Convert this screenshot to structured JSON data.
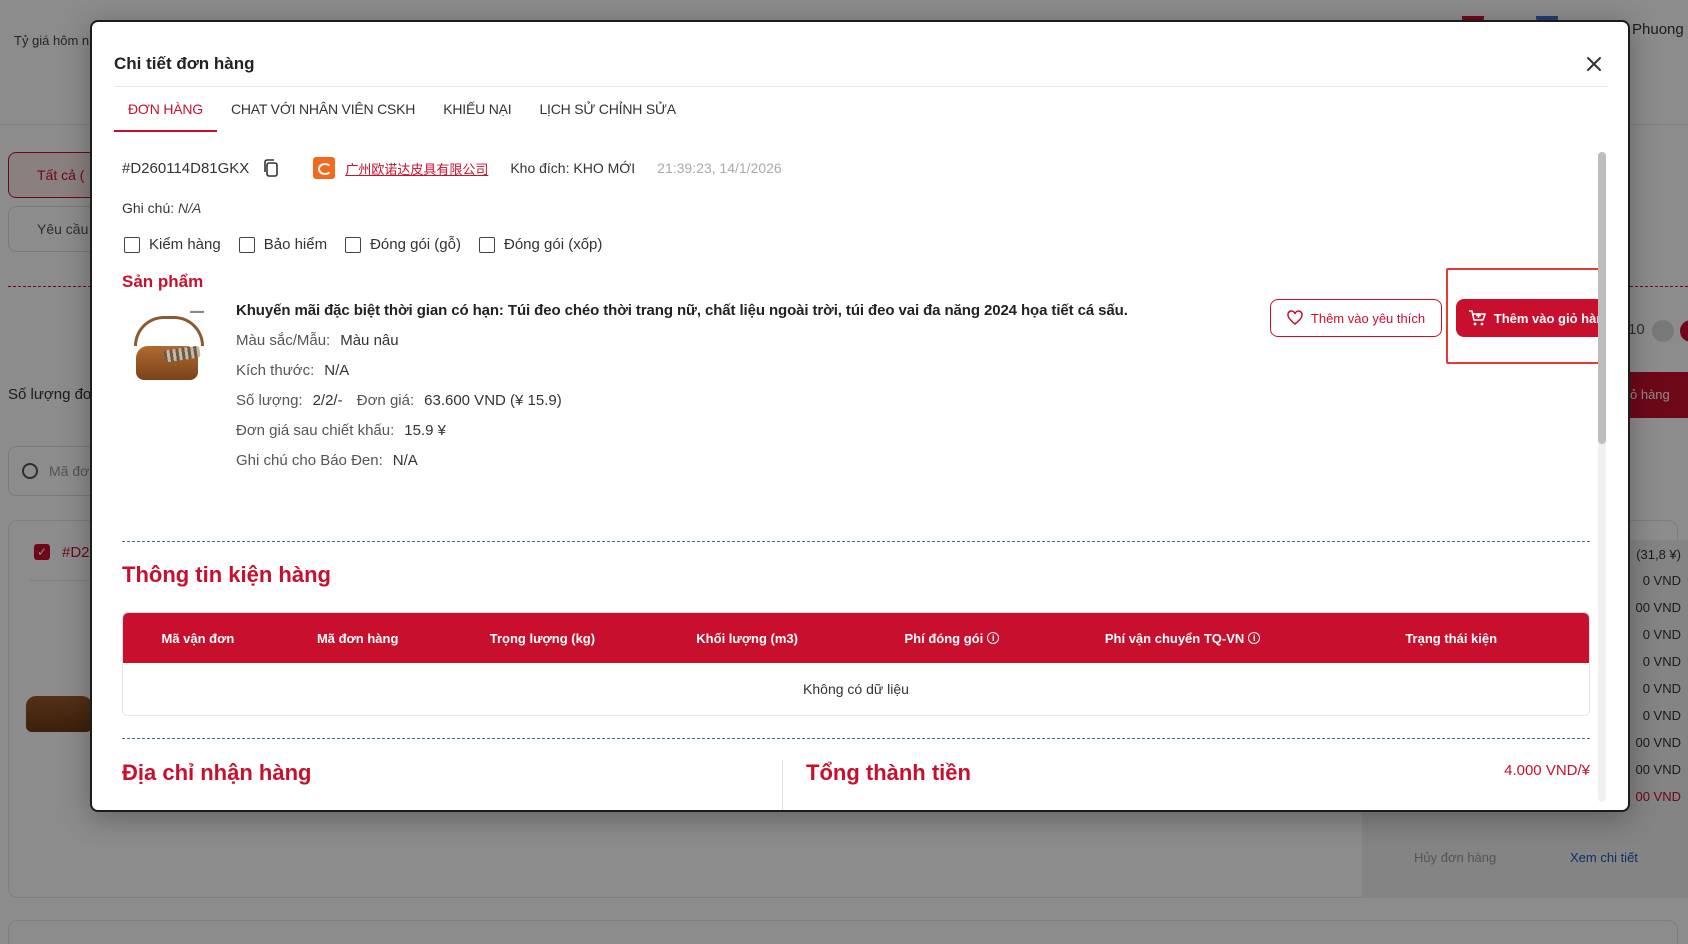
{
  "background": {
    "exchange_rate_label": "Tỷ giá hôm n",
    "user_name": "Phuong",
    "tab_all": "Tất cả (",
    "tab_request": "Yêu cầu",
    "order_count_label": "Số lượng đơ",
    "search_placeholder": "Mã đơ",
    "card_order_id": "#D2",
    "pager_text": "10",
    "cart_button": "ỏ hàng",
    "right_values": [
      "(31,8 ¥)",
      "0 VND",
      "00 VND",
      "0 VND",
      "0 VND",
      "0 VND",
      "0 VND",
      "00 VND",
      "00 VND",
      "00 VND"
    ],
    "cancel_order": "Hủy đơn hàng",
    "view_detail": "Xem chi tiết"
  },
  "modal": {
    "title": "Chi tiết đơn hàng",
    "close_icon": "close-icon",
    "tabs": [
      {
        "label": "ĐƠN HÀNG",
        "active": true
      },
      {
        "label": "CHAT VỚI NHÂN VIÊN CSKH",
        "active": false
      },
      {
        "label": "KHIẾU NẠI",
        "active": false
      },
      {
        "label": "LỊCH SỬ CHỈNH SỬA",
        "active": false
      }
    ],
    "order": {
      "id": "#D260114D81GKX",
      "shop_name": "广州欧诺达皮具有限公司",
      "warehouse": "Kho đích: KHO MỚI",
      "time": "21:39:23, 14/1/2026",
      "note_label": "Ghi chú:",
      "note_value": "N/A"
    },
    "options": [
      {
        "label": "Kiểm hàng",
        "checked": false
      },
      {
        "label": "Bảo hiểm",
        "checked": false
      },
      {
        "label": "Đóng gói (gỗ)",
        "checked": false
      },
      {
        "label": "Đóng gói (xốp)",
        "checked": false
      }
    ],
    "products_heading": "Sản phẩm",
    "product": {
      "title": "Khuyến mãi đặc biệt thời gian có hạn: Túi đeo chéo thời trang nữ, chất liệu ngoài trời, túi đeo vai đa năng 2024 họa tiết cá sấu.",
      "color_label": "Màu sắc/Mẫu:",
      "color_value": "Màu nâu",
      "size_label": "Kích thước:",
      "size_value": "N/A",
      "qty_label": "Số lượng:",
      "qty_value": "2/2/-",
      "price_label": "Đơn giá:",
      "price_value": "63.600 VND (¥ 15.9)",
      "discount_label": "Đơn giá sau chiết khấu:",
      "discount_value": "15.9 ¥",
      "note_label": "Ghi chú cho Báo Đen:",
      "note_value": "N/A",
      "wish_button": "Thêm vào yêu thích",
      "cart_button": "Thêm vào giỏ hàng"
    },
    "package_heading": "Thông tin kiện hàng",
    "package_columns": [
      "Mã vận đơn",
      "Mã đơn hàng",
      "Trọng lượng (kg)",
      "Khối lượng (m3)",
      "Phí đóng gói",
      "Phí vận chuyển TQ-VN",
      "Trạng thái kiện"
    ],
    "package_empty": "Không có dữ liệu",
    "address_heading": "Địa chỉ nhận hàng",
    "total_heading": "Tổng thành tiền",
    "rate_value": "4.000 VND/¥"
  },
  "colors": {
    "brand": "#c8102e",
    "highlight": "#e53935"
  }
}
